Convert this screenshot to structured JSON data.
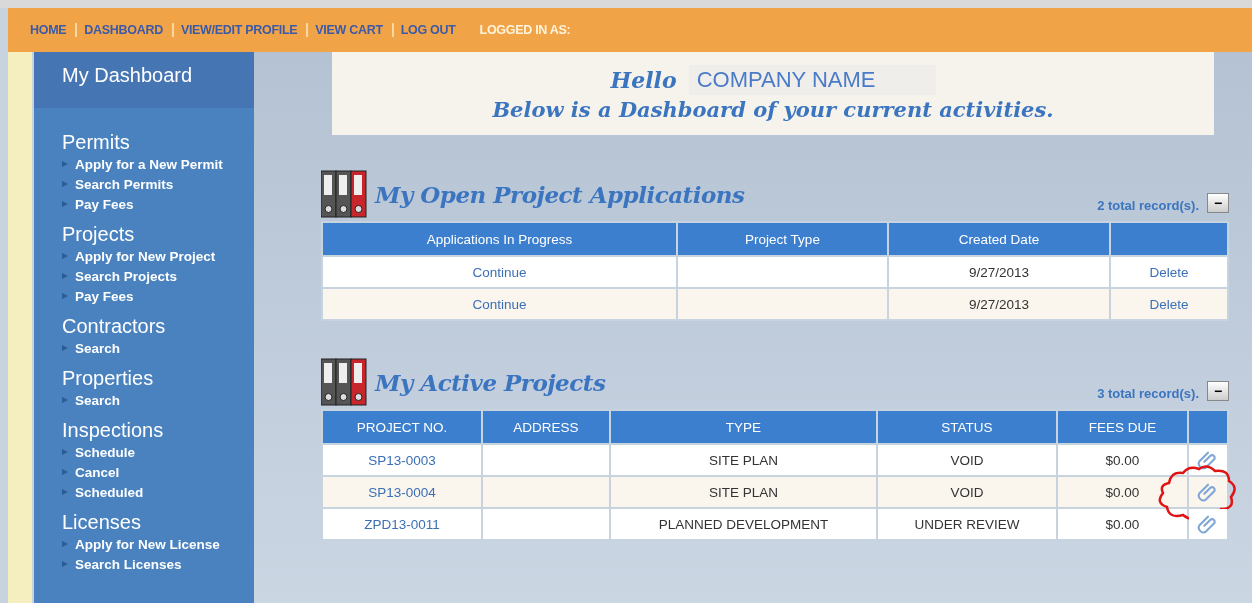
{
  "top_nav": {
    "links": [
      {
        "label": "HOME"
      },
      {
        "label": "DASHBOARD"
      },
      {
        "label": "VIEW/EDIT PROFILE"
      },
      {
        "label": "VIEW CART"
      },
      {
        "label": "LOG OUT"
      }
    ],
    "logged_in_label": "LOGGED IN AS:"
  },
  "sidebar": {
    "title": "My Dashboard",
    "groups": [
      {
        "heading": "Permits",
        "items": [
          "Apply for a New Permit",
          "Search Permits",
          "Pay Fees"
        ]
      },
      {
        "heading": "Projects",
        "items": [
          "Apply for New Project",
          "Search Projects",
          "Pay Fees"
        ]
      },
      {
        "heading": "Contractors",
        "items": [
          "Search"
        ]
      },
      {
        "heading": "Properties",
        "items": [
          "Search"
        ]
      },
      {
        "heading": "Inspections",
        "items": [
          "Schedule",
          "Cancel",
          "Scheduled"
        ]
      },
      {
        "heading": "Licenses",
        "items": [
          "Apply for New License",
          "Search Licenses"
        ]
      }
    ]
  },
  "greeting": {
    "hello": "Hello",
    "company_name": "COMPANY NAME",
    "message": "Below is a Dashboard of your current activities."
  },
  "sections": [
    {
      "title": "My Open Project Applications",
      "record_count": "2 total record(s).",
      "collapse_button": "−",
      "columns": [
        "Applications In Progress",
        "Project Type",
        "Created Date",
        ""
      ],
      "rows": [
        {
          "cells": [
            "Continue",
            "",
            "9/27/2013",
            "Delete"
          ]
        },
        {
          "cells": [
            "Continue",
            "",
            "9/27/2013",
            "Delete"
          ]
        }
      ]
    },
    {
      "title": "My Active Projects",
      "record_count": "3 total record(s).",
      "collapse_button": "−",
      "columns": [
        "PROJECT NO.",
        "ADDRESS",
        "TYPE",
        "STATUS",
        "FEES DUE",
        ""
      ],
      "rows": [
        {
          "cells": [
            "SP13-0003",
            "",
            "SITE PLAN",
            "VOID",
            "$0.00",
            ""
          ],
          "highlighted": false
        },
        {
          "cells": [
            "SP13-0004",
            "",
            "SITE PLAN",
            "VOID",
            "$0.00",
            ""
          ],
          "highlighted": true
        },
        {
          "cells": [
            "ZPD13-0011",
            "",
            "PLANNED DEVELOPMENT",
            "UNDER REVIEW",
            "$0.00",
            ""
          ],
          "highlighted": false
        }
      ]
    }
  ]
}
